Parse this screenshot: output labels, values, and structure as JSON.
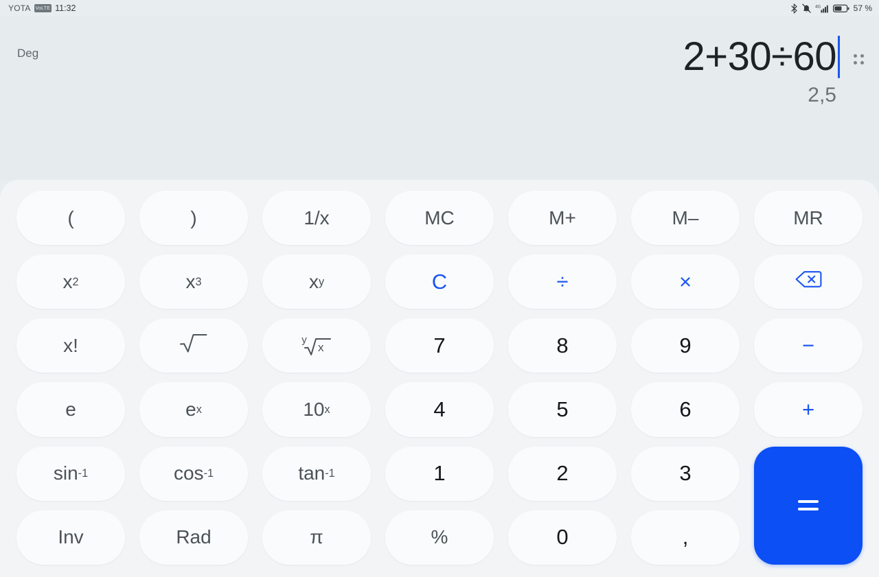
{
  "statusbar": {
    "carrier": "YOTA",
    "network_badge": "VoLTE",
    "time": "11:32",
    "battery_percent": "57 %",
    "icons": {
      "bluetooth": "bluetooth-icon",
      "ringer": "ringer-muted-icon",
      "signal": "signal-4g-icon",
      "battery": "battery-icon"
    }
  },
  "display": {
    "angle_mode": "Deg",
    "expression": "2+30÷60",
    "result": "2,5",
    "handle": "drag-handle-icon"
  },
  "colors": {
    "accent": "#1a56f0",
    "equals_bg": "#0b4ff5",
    "key_bg": "#fafbfc",
    "keypad_bg": "#f2f4f6",
    "display_bg": "#e6ebee"
  },
  "keypad": {
    "rows": [
      [
        {
          "label": "(",
          "name": "key-open-paren",
          "type": "fn"
        },
        {
          "label": ")",
          "name": "key-close-paren",
          "type": "fn"
        },
        {
          "label": "1/x",
          "name": "key-reciprocal",
          "type": "fn"
        },
        {
          "label": "MC",
          "name": "key-memory-clear",
          "type": "fn"
        },
        {
          "label": "M+",
          "name": "key-memory-add",
          "type": "fn"
        },
        {
          "label": "M–",
          "name": "key-memory-subtract",
          "type": "fn"
        },
        {
          "label": "MR",
          "name": "key-memory-recall",
          "type": "fn"
        }
      ],
      [
        {
          "label": "x2",
          "name": "key-square",
          "type": "sup",
          "base": "x",
          "sup": "2"
        },
        {
          "label": "x3",
          "name": "key-cube",
          "type": "sup",
          "base": "x",
          "sup": "3"
        },
        {
          "label": "xy",
          "name": "key-power",
          "type": "sup",
          "base": "x",
          "sup": "y"
        },
        {
          "label": "C",
          "name": "key-clear",
          "type": "op"
        },
        {
          "label": "÷",
          "name": "key-divide",
          "type": "op"
        },
        {
          "label": "×",
          "name": "key-multiply",
          "type": "op"
        },
        {
          "label": "⌫",
          "name": "key-backspace",
          "type": "icon"
        }
      ],
      [
        {
          "label": "x!",
          "name": "key-factorial",
          "type": "fn"
        },
        {
          "label": "√",
          "name": "key-square-root",
          "type": "radical"
        },
        {
          "label": "y√x",
          "name": "key-nth-root",
          "type": "nthroot",
          "index": "y",
          "radicand": "x"
        },
        {
          "label": "7",
          "name": "key-7",
          "type": "num"
        },
        {
          "label": "8",
          "name": "key-8",
          "type": "num"
        },
        {
          "label": "9",
          "name": "key-9",
          "type": "num"
        },
        {
          "label": "−",
          "name": "key-subtract",
          "type": "op"
        }
      ],
      [
        {
          "label": "e",
          "name": "key-euler",
          "type": "fn"
        },
        {
          "label": "ex",
          "name": "key-exp",
          "type": "sup",
          "base": "e",
          "sup": "x"
        },
        {
          "label": "10x",
          "name": "key-ten-power",
          "type": "sup",
          "base": "10",
          "sup": "x"
        },
        {
          "label": "4",
          "name": "key-4",
          "type": "num"
        },
        {
          "label": "5",
          "name": "key-5",
          "type": "num"
        },
        {
          "label": "6",
          "name": "key-6",
          "type": "num"
        },
        {
          "label": "+",
          "name": "key-add",
          "type": "op"
        }
      ],
      [
        {
          "label": "sin-1",
          "name": "key-arcsin",
          "type": "sup",
          "base": "sin",
          "sup": "-1"
        },
        {
          "label": "cos-1",
          "name": "key-arccos",
          "type": "sup",
          "base": "cos",
          "sup": "-1"
        },
        {
          "label": "tan-1",
          "name": "key-arctan",
          "type": "sup",
          "base": "tan",
          "sup": "-1"
        },
        {
          "label": "1",
          "name": "key-1",
          "type": "num"
        },
        {
          "label": "2",
          "name": "key-2",
          "type": "num"
        },
        {
          "label": "3",
          "name": "key-3",
          "type": "num"
        },
        {
          "label": "=",
          "name": "key-equals",
          "type": "equals"
        }
      ],
      [
        {
          "label": "Inv",
          "name": "key-inverse",
          "type": "fn"
        },
        {
          "label": "Rad",
          "name": "key-radian",
          "type": "fn"
        },
        {
          "label": "π",
          "name": "key-pi",
          "type": "fn"
        },
        {
          "label": "%",
          "name": "key-percent",
          "type": "fn"
        },
        {
          "label": "0",
          "name": "key-0",
          "type": "num"
        },
        {
          "label": ",",
          "name": "key-decimal-comma",
          "type": "num"
        }
      ]
    ]
  }
}
